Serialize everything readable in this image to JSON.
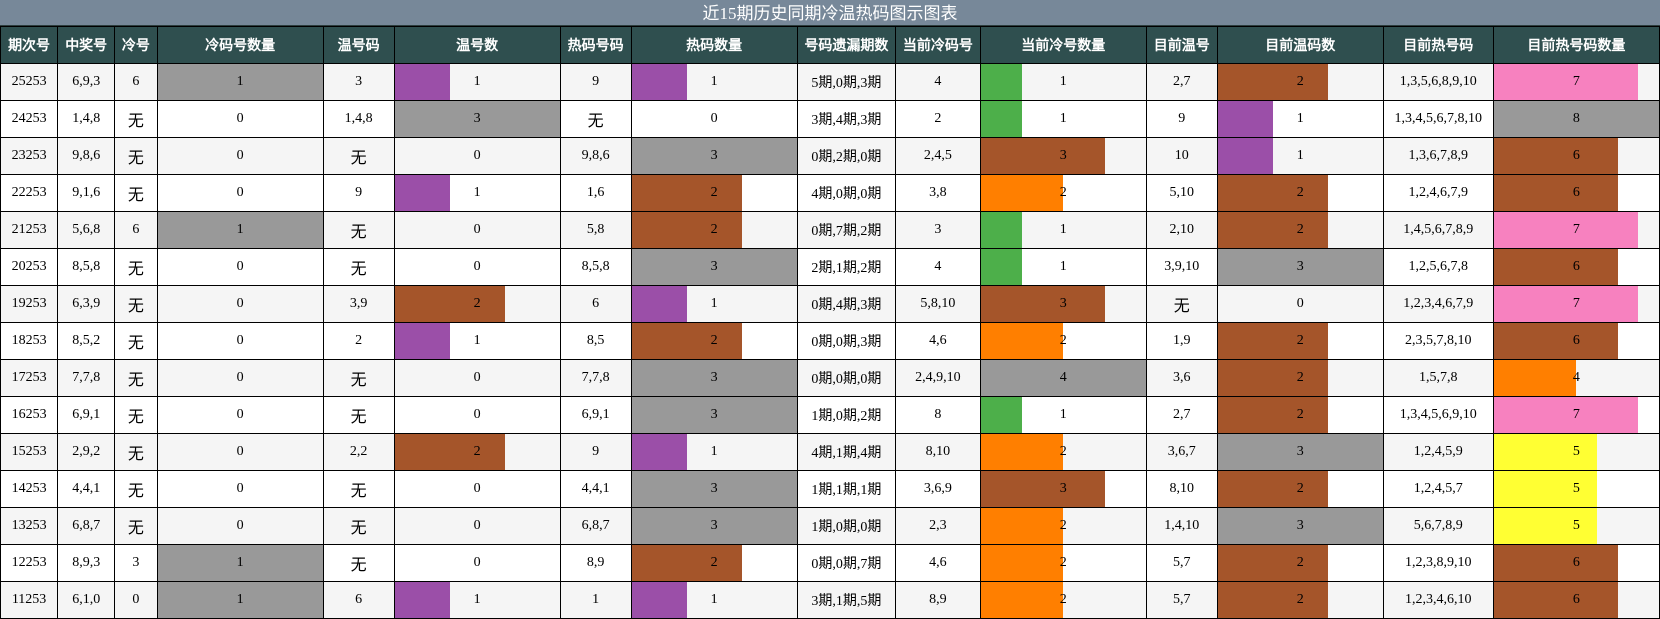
{
  "title": "近15期历史同期冷温热码图示图表",
  "scale_max": 8,
  "headers": [
    "期次号",
    "中奖号",
    "冷号",
    "冷码号数量",
    "温号码",
    "温号数",
    "热码号码",
    "热码数量",
    "号码遗漏期数",
    "当前冷码号",
    "当前冷号数量",
    "目前温号",
    "目前温码数",
    "目前热号码",
    "目前热号码数量"
  ],
  "colors": {
    "1": "#9b4fa8",
    "2": "#a5552a",
    "3": "#999999",
    "4": "#999999",
    "5": "#ffff33",
    "6": "#a5552a",
    "7": "#f781bf",
    "8": "#999999"
  },
  "colors_current_cold": {
    "1": "#4daf4a",
    "2": "#ff7f00",
    "3": "#a5552a",
    "4": "#999999"
  },
  "colors_hot_count": {
    "4": "#ff7f00",
    "5": "#ffff33",
    "6": "#a5552a",
    "7": "#f781bf",
    "8": "#999999"
  },
  "rows": [
    {
      "period": "25253",
      "draw": "6,9,3",
      "cold": "6",
      "cold_count": 1,
      "warm": "3",
      "warm_count": 1,
      "hot": "9",
      "hot_count": 1,
      "miss": "5期,0期,3期",
      "cur_cold": "4",
      "cur_cold_count": 1,
      "cur_warm": "2,7",
      "cur_warm_count": 2,
      "cur_hot": "1,3,5,6,8,9,10",
      "cur_hot_count": 7
    },
    {
      "period": "24253",
      "draw": "1,4,8",
      "cold": "无",
      "cold_count": 0,
      "warm": "1,4,8",
      "warm_count": 3,
      "hot": "无",
      "hot_count": 0,
      "miss": "3期,4期,3期",
      "cur_cold": "2",
      "cur_cold_count": 1,
      "cur_warm": "9",
      "cur_warm_count": 1,
      "cur_hot": "1,3,4,5,6,7,8,10",
      "cur_hot_count": 8
    },
    {
      "period": "23253",
      "draw": "9,8,6",
      "cold": "无",
      "cold_count": 0,
      "warm": "无",
      "warm_count": 0,
      "hot": "9,8,6",
      "hot_count": 3,
      "miss": "0期,2期,0期",
      "cur_cold": "2,4,5",
      "cur_cold_count": 3,
      "cur_warm": "10",
      "cur_warm_count": 1,
      "cur_hot": "1,3,6,7,8,9",
      "cur_hot_count": 6
    },
    {
      "period": "22253",
      "draw": "9,1,6",
      "cold": "无",
      "cold_count": 0,
      "warm": "9",
      "warm_count": 1,
      "hot": "1,6",
      "hot_count": 2,
      "miss": "4期,0期,0期",
      "cur_cold": "3,8",
      "cur_cold_count": 2,
      "cur_warm": "5,10",
      "cur_warm_count": 2,
      "cur_hot": "1,2,4,6,7,9",
      "cur_hot_count": 6
    },
    {
      "period": "21253",
      "draw": "5,6,8",
      "cold": "6",
      "cold_count": 1,
      "warm": "无",
      "warm_count": 0,
      "hot": "5,8",
      "hot_count": 2,
      "miss": "0期,7期,2期",
      "cur_cold": "3",
      "cur_cold_count": 1,
      "cur_warm": "2,10",
      "cur_warm_count": 2,
      "cur_hot": "1,4,5,6,7,8,9",
      "cur_hot_count": 7
    },
    {
      "period": "20253",
      "draw": "8,5,8",
      "cold": "无",
      "cold_count": 0,
      "warm": "无",
      "warm_count": 0,
      "hot": "8,5,8",
      "hot_count": 3,
      "miss": "2期,1期,2期",
      "cur_cold": "4",
      "cur_cold_count": 1,
      "cur_warm": "3,9,10",
      "cur_warm_count": 3,
      "cur_hot": "1,2,5,6,7,8",
      "cur_hot_count": 6
    },
    {
      "period": "19253",
      "draw": "6,3,9",
      "cold": "无",
      "cold_count": 0,
      "warm": "3,9",
      "warm_count": 2,
      "hot": "6",
      "hot_count": 1,
      "miss": "0期,4期,3期",
      "cur_cold": "5,8,10",
      "cur_cold_count": 3,
      "cur_warm": "无",
      "cur_warm_count": 0,
      "cur_hot": "1,2,3,4,6,7,9",
      "cur_hot_count": 7
    },
    {
      "period": "18253",
      "draw": "8,5,2",
      "cold": "无",
      "cold_count": 0,
      "warm": "2",
      "warm_count": 1,
      "hot": "8,5",
      "hot_count": 2,
      "miss": "0期,0期,3期",
      "cur_cold": "4,6",
      "cur_cold_count": 2,
      "cur_warm": "1,9",
      "cur_warm_count": 2,
      "cur_hot": "2,3,5,7,8,10",
      "cur_hot_count": 6
    },
    {
      "period": "17253",
      "draw": "7,7,8",
      "cold": "无",
      "cold_count": 0,
      "warm": "无",
      "warm_count": 0,
      "hot": "7,7,8",
      "hot_count": 3,
      "miss": "0期,0期,0期",
      "cur_cold": "2,4,9,10",
      "cur_cold_count": 4,
      "cur_warm": "3,6",
      "cur_warm_count": 2,
      "cur_hot": "1,5,7,8",
      "cur_hot_count": 4
    },
    {
      "period": "16253",
      "draw": "6,9,1",
      "cold": "无",
      "cold_count": 0,
      "warm": "无",
      "warm_count": 0,
      "hot": "6,9,1",
      "hot_count": 3,
      "miss": "1期,0期,2期",
      "cur_cold": "8",
      "cur_cold_count": 1,
      "cur_warm": "2,7",
      "cur_warm_count": 2,
      "cur_hot": "1,3,4,5,6,9,10",
      "cur_hot_count": 7
    },
    {
      "period": "15253",
      "draw": "2,9,2",
      "cold": "无",
      "cold_count": 0,
      "warm": "2,2",
      "warm_count": 2,
      "hot": "9",
      "hot_count": 1,
      "miss": "4期,1期,4期",
      "cur_cold": "8,10",
      "cur_cold_count": 2,
      "cur_warm": "3,6,7",
      "cur_warm_count": 3,
      "cur_hot": "1,2,4,5,9",
      "cur_hot_count": 5
    },
    {
      "period": "14253",
      "draw": "4,4,1",
      "cold": "无",
      "cold_count": 0,
      "warm": "无",
      "warm_count": 0,
      "hot": "4,4,1",
      "hot_count": 3,
      "miss": "1期,1期,1期",
      "cur_cold": "3,6,9",
      "cur_cold_count": 3,
      "cur_warm": "8,10",
      "cur_warm_count": 2,
      "cur_hot": "1,2,4,5,7",
      "cur_hot_count": 5
    },
    {
      "period": "13253",
      "draw": "6,8,7",
      "cold": "无",
      "cold_count": 0,
      "warm": "无",
      "warm_count": 0,
      "hot": "6,8,7",
      "hot_count": 3,
      "miss": "1期,0期,0期",
      "cur_cold": "2,3",
      "cur_cold_count": 2,
      "cur_warm": "1,4,10",
      "cur_warm_count": 3,
      "cur_hot": "5,6,7,8,9",
      "cur_hot_count": 5
    },
    {
      "period": "12253",
      "draw": "8,9,3",
      "cold": "3",
      "cold_count": 1,
      "warm": "无",
      "warm_count": 0,
      "hot": "8,9",
      "hot_count": 2,
      "miss": "0期,0期,7期",
      "cur_cold": "4,6",
      "cur_cold_count": 2,
      "cur_warm": "5,7",
      "cur_warm_count": 2,
      "cur_hot": "1,2,3,8,9,10",
      "cur_hot_count": 6
    },
    {
      "period": "11253",
      "draw": "6,1,0",
      "cold": "0",
      "cold_count": 1,
      "warm": "6",
      "warm_count": 1,
      "hot": "1",
      "hot_count": 1,
      "miss": "3期,1期,5期",
      "cur_cold": "8,9",
      "cur_cold_count": 2,
      "cur_warm": "5,7",
      "cur_warm_count": 2,
      "cur_hot": "1,2,3,4,6,10",
      "cur_hot_count": 6
    }
  ]
}
